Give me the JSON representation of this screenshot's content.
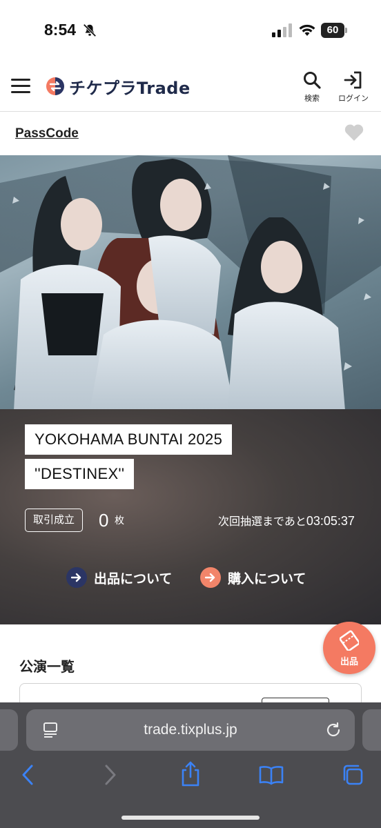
{
  "status_bar": {
    "time": "8:54",
    "battery": "60"
  },
  "header": {
    "logo_text": "チケプラTrade",
    "search_label": "検索",
    "login_label": "ログイン"
  },
  "artist": {
    "name": "PassCode"
  },
  "event": {
    "title_line1": "YOKOHAMA BUNTAI 2025",
    "title_line2": "''DESTINEX''",
    "trade_badge": "取引成立",
    "trade_count": "0",
    "trade_unit": "枚",
    "lottery_prefix": "次回抽選まであと",
    "lottery_time": "03:05:37",
    "sell_info": "出品について",
    "buy_info": "購入について"
  },
  "performances": {
    "heading": "公演一覧"
  },
  "fab": {
    "label": "出品"
  },
  "browser": {
    "url": "trade.tixplus.jp"
  },
  "colors": {
    "brand_navy": "#2b3564",
    "brand_coral": "#f47a62",
    "safari_bar": "#4c4c50",
    "safari_blue": "#3b82f6"
  },
  "icons": [
    "bell-slash-icon",
    "signal-icon",
    "wifi-icon",
    "menu-icon",
    "search-icon",
    "login-icon",
    "heart-icon",
    "arrow-right-icon",
    "ticket-icon",
    "page-menu-icon",
    "reload-icon",
    "back-icon",
    "forward-icon",
    "share-icon",
    "bookmarks-icon",
    "tabs-icon"
  ]
}
